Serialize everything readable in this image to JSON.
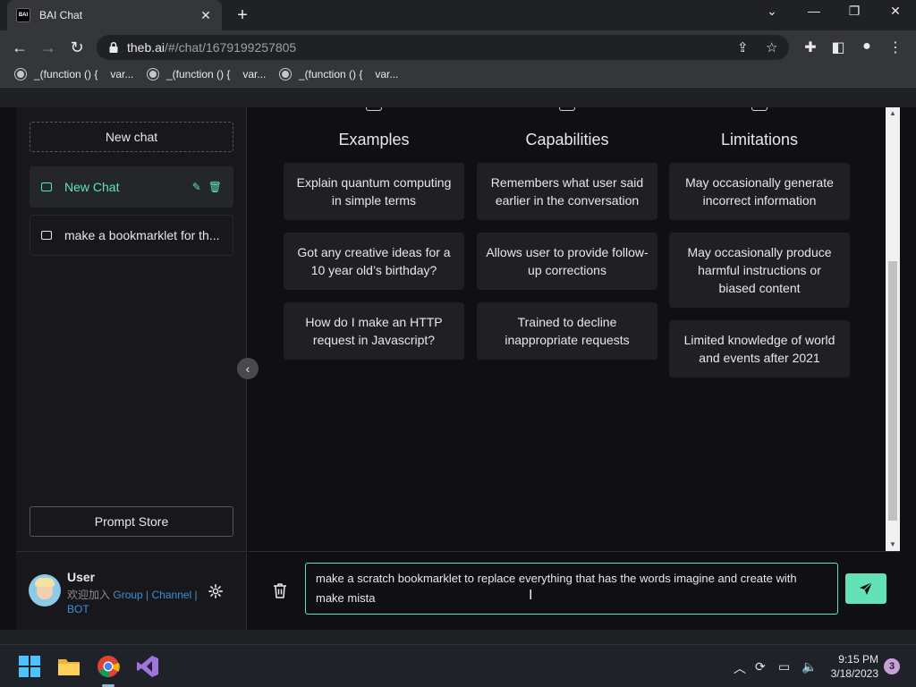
{
  "browser": {
    "tab_title": "BAI Chat",
    "favicon_text": "BAI",
    "url_host": "theb.ai",
    "url_path": "/#/chat/1679199257805",
    "bookmarks": [
      {
        "label": "_(function () {",
        "suffix": "var..."
      },
      {
        "label": "_(function () {",
        "suffix": "var..."
      },
      {
        "label": "_(function () {",
        "suffix": "var..."
      }
    ]
  },
  "sidebar": {
    "new_chat_button": "New chat",
    "chats": [
      {
        "label": "New Chat",
        "active": true
      },
      {
        "label": "make a bookmarklet for th...",
        "active": false
      }
    ],
    "prompt_store_button": "Prompt Store",
    "user": {
      "name": "User",
      "welcome": "欢迎加入",
      "group": "Group",
      "sep1": " | ",
      "channel": "Channel",
      "sep2": " |",
      "bot": "BOT"
    }
  },
  "main": {
    "columns": [
      {
        "title": "Examples",
        "items": [
          "Explain quantum computing in simple terms",
          "Got any creative ideas for a 10 year old’s birthday?",
          "How do I make an HTTP request in Javascript?"
        ]
      },
      {
        "title": "Capabilities",
        "items": [
          "Remembers what user said earlier in the conversation",
          "Allows user to provide follow-up corrections",
          "Trained to decline inappropriate requests"
        ]
      },
      {
        "title": "Limitations",
        "items": [
          "May occasionally generate incorrect information",
          "May occasionally produce harmful instructions or biased content",
          "Limited knowledge of world and events after 2021"
        ]
      }
    ]
  },
  "input": {
    "value": "make a scratch bookmarklet to replace everything that has the words imagine and create with make mista"
  },
  "taskbar": {
    "time": "9:15 PM",
    "date": "3/18/2023",
    "notification_count": "3"
  },
  "colors": {
    "accent": "#63e2b7",
    "background": "#101014",
    "sidebar": "#18181c",
    "card": "#1f1f24",
    "link": "#3e8ed0"
  }
}
